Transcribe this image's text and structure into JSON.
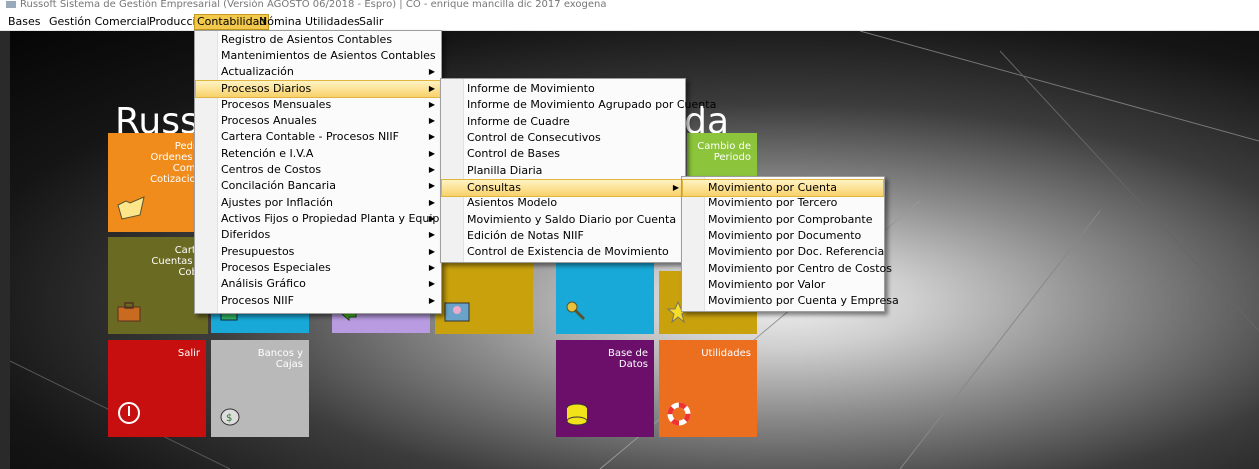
{
  "window": {
    "title": "Russoft Sistema de Gestión Empresarial (Versión AGOSTO 06/2018 - Espro) | CO - enrique mancilla dic 2017 exogena"
  },
  "menubar": [
    {
      "label": "Bases"
    },
    {
      "label": "Gestión Comercial"
    },
    {
      "label": "Producción"
    },
    {
      "label": "Contabilidad"
    },
    {
      "label": "Nómina"
    },
    {
      "label": "Utilidades"
    },
    {
      "label": "Salir"
    }
  ],
  "desktop": {
    "title_left": "Russo",
    "title_right": "ltda",
    "tiles": [
      {
        "label": "Pedid\nOrdenes d\nComp\nCotizacion",
        "color": "#f08c1c"
      },
      {
        "label": "Carte\nCuentas p\nCobr",
        "color": "#6b6a23"
      },
      {
        "label": "Salir",
        "color": "#c80f0f"
      },
      {
        "label": "Bancos y\nCajas",
        "color": "#b9b9b9"
      },
      {
        "label": "",
        "color": "#18a9d8"
      },
      {
        "label": "",
        "color": "#b89be0"
      },
      {
        "label": "",
        "color": "#c8a10d"
      },
      {
        "label": "",
        "color": "#18a9d8"
      },
      {
        "label": "Cambio de\nPeriodo",
        "color": "#8cc43c"
      },
      {
        "label": "",
        "color": "#c8a10d"
      },
      {
        "label": "Base de\nDatos",
        "color": "#6b0f6b"
      },
      {
        "label": "Utilidades",
        "color": "#ec6e1f"
      }
    ]
  },
  "menu_contabilidad": [
    "Registro de Asientos Contables",
    "Mantenimientos de Asientos Contables",
    "Actualización",
    "Procesos Diarios",
    "Procesos Mensuales",
    "Procesos Anuales",
    "Cartera Contable - Procesos NIIF",
    "Retención e I.V.A",
    "Centros de Costos",
    "Concilación Bancaria",
    "Ajustes por Inflación",
    "Activos Fijos o Propiedad Planta y Equipo NIIF",
    "Diferidos",
    "Presupuestos",
    "Procesos Especiales",
    "Análisis Gráfico",
    "Procesos NIIF"
  ],
  "menu_procesos_diarios": [
    "Informe de Movimiento",
    "Informe de Movimiento Agrupado por Cuenta",
    "Informe de Cuadre",
    "Control de Consecutivos",
    "Control de Bases",
    "Planilla Diaria",
    "Consultas",
    "Asientos Modelo",
    "Movimiento y Saldo Diario por Cuenta",
    "Edición de Notas NIIF",
    "Control de Existencia de Movimiento"
  ],
  "menu_consultas": [
    "Movimiento por Cuenta",
    "Movimiento por Tercero",
    "Movimiento por Comprobante",
    "Movimiento por Documento",
    "Movimiento por Doc. Referencia",
    "Movimiento por Centro de Costos",
    "Movimiento por Valor",
    "Movimiento por Cuenta y Empresa"
  ]
}
